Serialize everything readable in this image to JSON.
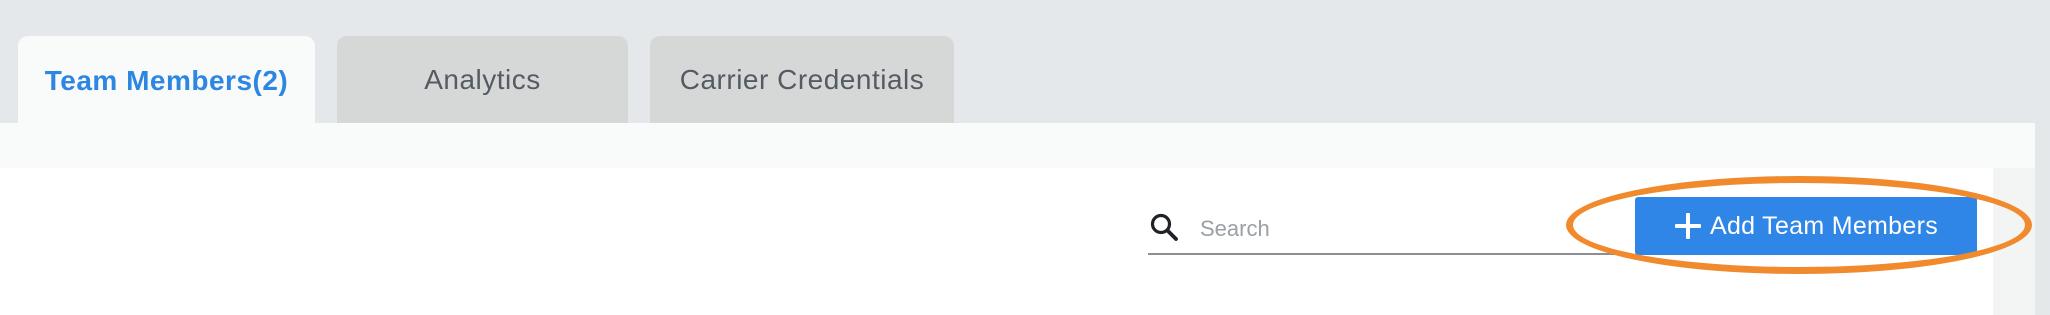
{
  "tabs": [
    {
      "label": "Team Members(2)",
      "active": true
    },
    {
      "label": "Analytics",
      "active": false
    },
    {
      "label": "Carrier Credentials",
      "active": false
    }
  ],
  "search": {
    "placeholder": "Search",
    "value": "",
    "icon": "search-icon"
  },
  "actions": {
    "add_label": "Add Team Members",
    "add_icon": "plus-icon"
  },
  "colors": {
    "accent": "#2f86e6",
    "active_tab_text": "#2d86e1",
    "highlight": "#f08a2c",
    "background": "#e4e8eb"
  }
}
